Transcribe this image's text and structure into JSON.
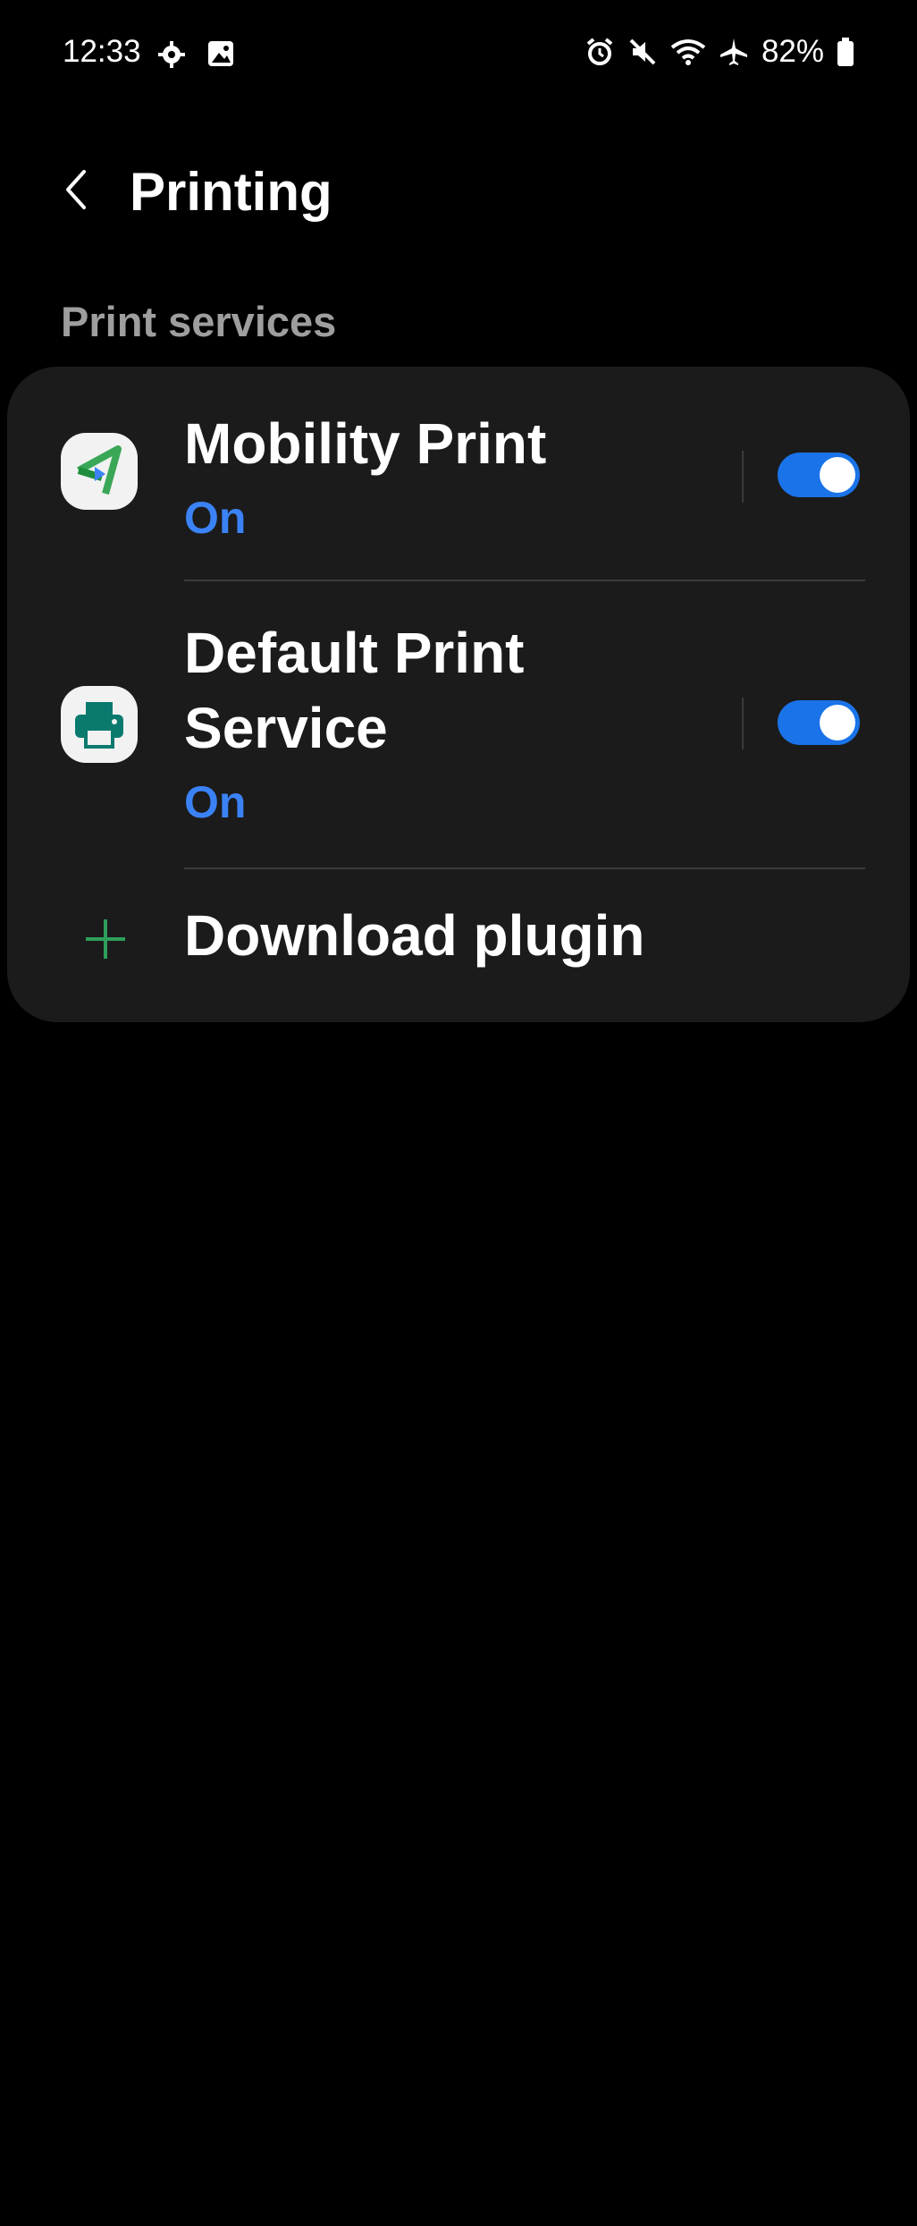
{
  "status_bar": {
    "time": "12:33",
    "battery": "82%"
  },
  "header": {
    "title": "Printing"
  },
  "section": {
    "label": "Print services"
  },
  "services": [
    {
      "name": "Mobility Print",
      "status": "On",
      "enabled": true
    },
    {
      "name_line1": "Default Print",
      "name_line2": "Service",
      "status": "On",
      "enabled": true
    }
  ],
  "download": {
    "label": "Download plugin"
  },
  "colors": {
    "accent": "#1a73e8",
    "status_on": "#3b82f6",
    "plus_green": "#2e9e5b",
    "card_bg": "#1b1b1b"
  }
}
